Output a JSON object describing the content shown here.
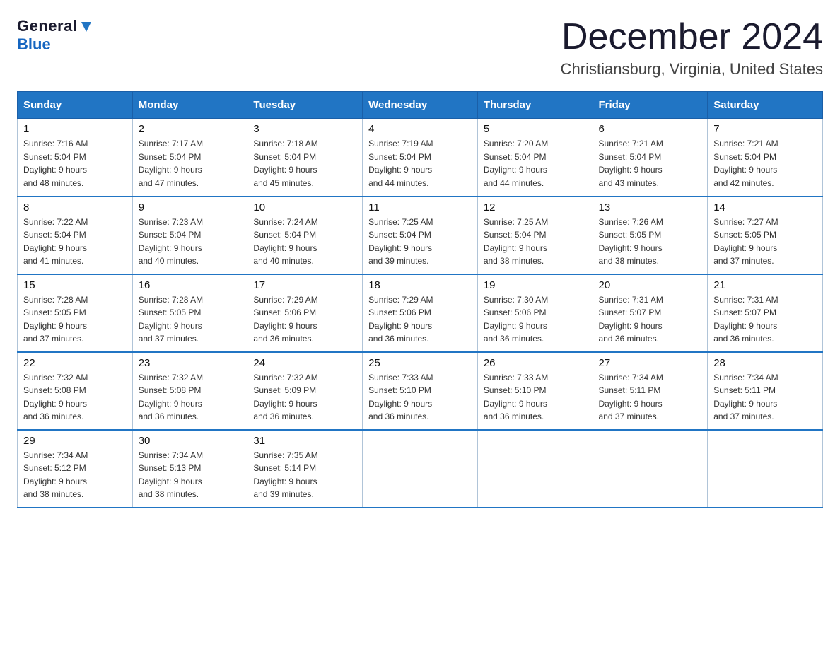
{
  "logo": {
    "general": "General",
    "arrow": "▶",
    "blue": "Blue"
  },
  "header": {
    "month": "December 2024",
    "location": "Christiansburg, Virginia, United States"
  },
  "weekdays": [
    "Sunday",
    "Monday",
    "Tuesday",
    "Wednesday",
    "Thursday",
    "Friday",
    "Saturday"
  ],
  "weeks": [
    [
      {
        "day": "1",
        "sunrise": "7:16 AM",
        "sunset": "5:04 PM",
        "daylight": "9 hours and 48 minutes."
      },
      {
        "day": "2",
        "sunrise": "7:17 AM",
        "sunset": "5:04 PM",
        "daylight": "9 hours and 47 minutes."
      },
      {
        "day": "3",
        "sunrise": "7:18 AM",
        "sunset": "5:04 PM",
        "daylight": "9 hours and 45 minutes."
      },
      {
        "day": "4",
        "sunrise": "7:19 AM",
        "sunset": "5:04 PM",
        "daylight": "9 hours and 44 minutes."
      },
      {
        "day": "5",
        "sunrise": "7:20 AM",
        "sunset": "5:04 PM",
        "daylight": "9 hours and 44 minutes."
      },
      {
        "day": "6",
        "sunrise": "7:21 AM",
        "sunset": "5:04 PM",
        "daylight": "9 hours and 43 minutes."
      },
      {
        "day": "7",
        "sunrise": "7:21 AM",
        "sunset": "5:04 PM",
        "daylight": "9 hours and 42 minutes."
      }
    ],
    [
      {
        "day": "8",
        "sunrise": "7:22 AM",
        "sunset": "5:04 PM",
        "daylight": "9 hours and 41 minutes."
      },
      {
        "day": "9",
        "sunrise": "7:23 AM",
        "sunset": "5:04 PM",
        "daylight": "9 hours and 40 minutes."
      },
      {
        "day": "10",
        "sunrise": "7:24 AM",
        "sunset": "5:04 PM",
        "daylight": "9 hours and 40 minutes."
      },
      {
        "day": "11",
        "sunrise": "7:25 AM",
        "sunset": "5:04 PM",
        "daylight": "9 hours and 39 minutes."
      },
      {
        "day": "12",
        "sunrise": "7:25 AM",
        "sunset": "5:04 PM",
        "daylight": "9 hours and 38 minutes."
      },
      {
        "day": "13",
        "sunrise": "7:26 AM",
        "sunset": "5:05 PM",
        "daylight": "9 hours and 38 minutes."
      },
      {
        "day": "14",
        "sunrise": "7:27 AM",
        "sunset": "5:05 PM",
        "daylight": "9 hours and 37 minutes."
      }
    ],
    [
      {
        "day": "15",
        "sunrise": "7:28 AM",
        "sunset": "5:05 PM",
        "daylight": "9 hours and 37 minutes."
      },
      {
        "day": "16",
        "sunrise": "7:28 AM",
        "sunset": "5:05 PM",
        "daylight": "9 hours and 37 minutes."
      },
      {
        "day": "17",
        "sunrise": "7:29 AM",
        "sunset": "5:06 PM",
        "daylight": "9 hours and 36 minutes."
      },
      {
        "day": "18",
        "sunrise": "7:29 AM",
        "sunset": "5:06 PM",
        "daylight": "9 hours and 36 minutes."
      },
      {
        "day": "19",
        "sunrise": "7:30 AM",
        "sunset": "5:06 PM",
        "daylight": "9 hours and 36 minutes."
      },
      {
        "day": "20",
        "sunrise": "7:31 AM",
        "sunset": "5:07 PM",
        "daylight": "9 hours and 36 minutes."
      },
      {
        "day": "21",
        "sunrise": "7:31 AM",
        "sunset": "5:07 PM",
        "daylight": "9 hours and 36 minutes."
      }
    ],
    [
      {
        "day": "22",
        "sunrise": "7:32 AM",
        "sunset": "5:08 PM",
        "daylight": "9 hours and 36 minutes."
      },
      {
        "day": "23",
        "sunrise": "7:32 AM",
        "sunset": "5:08 PM",
        "daylight": "9 hours and 36 minutes."
      },
      {
        "day": "24",
        "sunrise": "7:32 AM",
        "sunset": "5:09 PM",
        "daylight": "9 hours and 36 minutes."
      },
      {
        "day": "25",
        "sunrise": "7:33 AM",
        "sunset": "5:10 PM",
        "daylight": "9 hours and 36 minutes."
      },
      {
        "day": "26",
        "sunrise": "7:33 AM",
        "sunset": "5:10 PM",
        "daylight": "9 hours and 36 minutes."
      },
      {
        "day": "27",
        "sunrise": "7:34 AM",
        "sunset": "5:11 PM",
        "daylight": "9 hours and 37 minutes."
      },
      {
        "day": "28",
        "sunrise": "7:34 AM",
        "sunset": "5:11 PM",
        "daylight": "9 hours and 37 minutes."
      }
    ],
    [
      {
        "day": "29",
        "sunrise": "7:34 AM",
        "sunset": "5:12 PM",
        "daylight": "9 hours and 38 minutes."
      },
      {
        "day": "30",
        "sunrise": "7:34 AM",
        "sunset": "5:13 PM",
        "daylight": "9 hours and 38 minutes."
      },
      {
        "day": "31",
        "sunrise": "7:35 AM",
        "sunset": "5:14 PM",
        "daylight": "9 hours and 39 minutes."
      },
      null,
      null,
      null,
      null
    ]
  ],
  "labels": {
    "sunrise": "Sunrise:",
    "sunset": "Sunset:",
    "daylight": "Daylight:"
  }
}
